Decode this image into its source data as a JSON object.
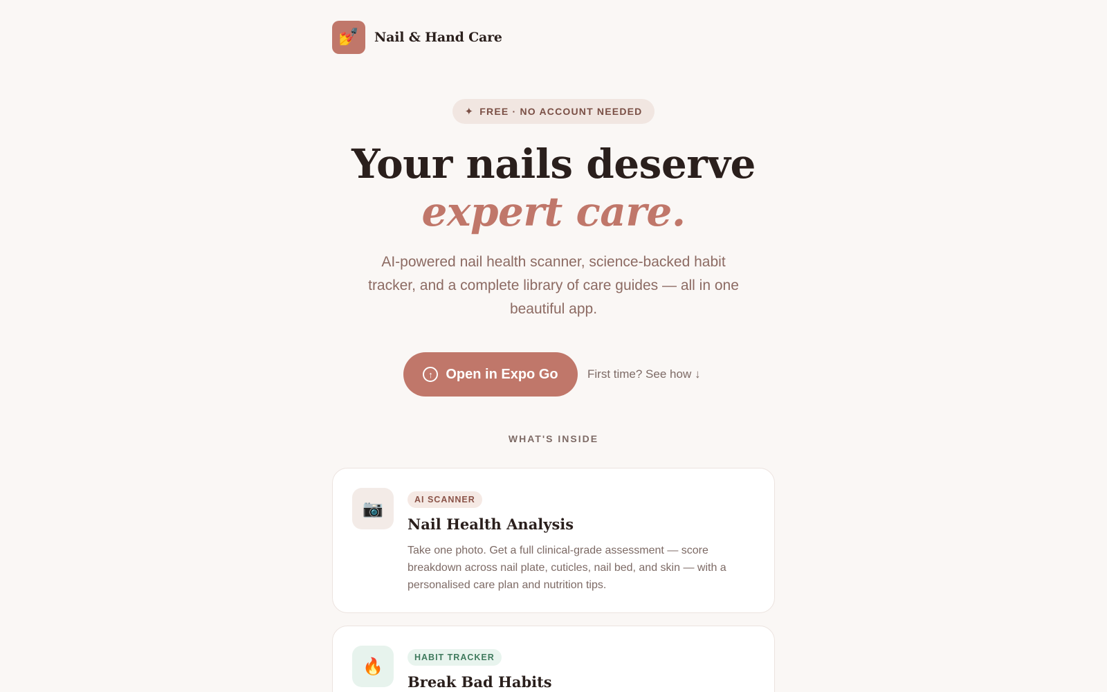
{
  "brand": {
    "logo_icon": "💅",
    "name": "Nail & Hand Care",
    "logo_color": "#c0776a"
  },
  "hero": {
    "badge_icon": "✦",
    "badge_text": "FREE · NO ACCOUNT NEEDED",
    "headline_line1": "Your nails deserve",
    "headline_line2": "expert care.",
    "subtitle": "AI-powered nail health scanner, science-backed habit tracker, and a complete library of care guides — all in one beautiful app.",
    "cta_icon": "↑",
    "cta_label": "Open in Expo Go",
    "secondary_link": "First time? See how ↓",
    "accent_color": "#c0776a"
  },
  "features": {
    "section_label": "WHAT'S INSIDE",
    "cards": [
      {
        "icon": "📷",
        "icon_name": "camera-icon",
        "tag": "AI SCANNER",
        "title": "Nail Health Analysis",
        "description": "Take one photo. Get a full clinical-grade assessment — score breakdown across nail plate, cuticles, nail bed, and skin — with a personalised care plan and nutrition tips."
      },
      {
        "icon": "🔥",
        "icon_name": "flame-icon",
        "tag": "HABIT TRACKER",
        "title": "Break Bad Habits",
        "description": ""
      }
    ]
  }
}
